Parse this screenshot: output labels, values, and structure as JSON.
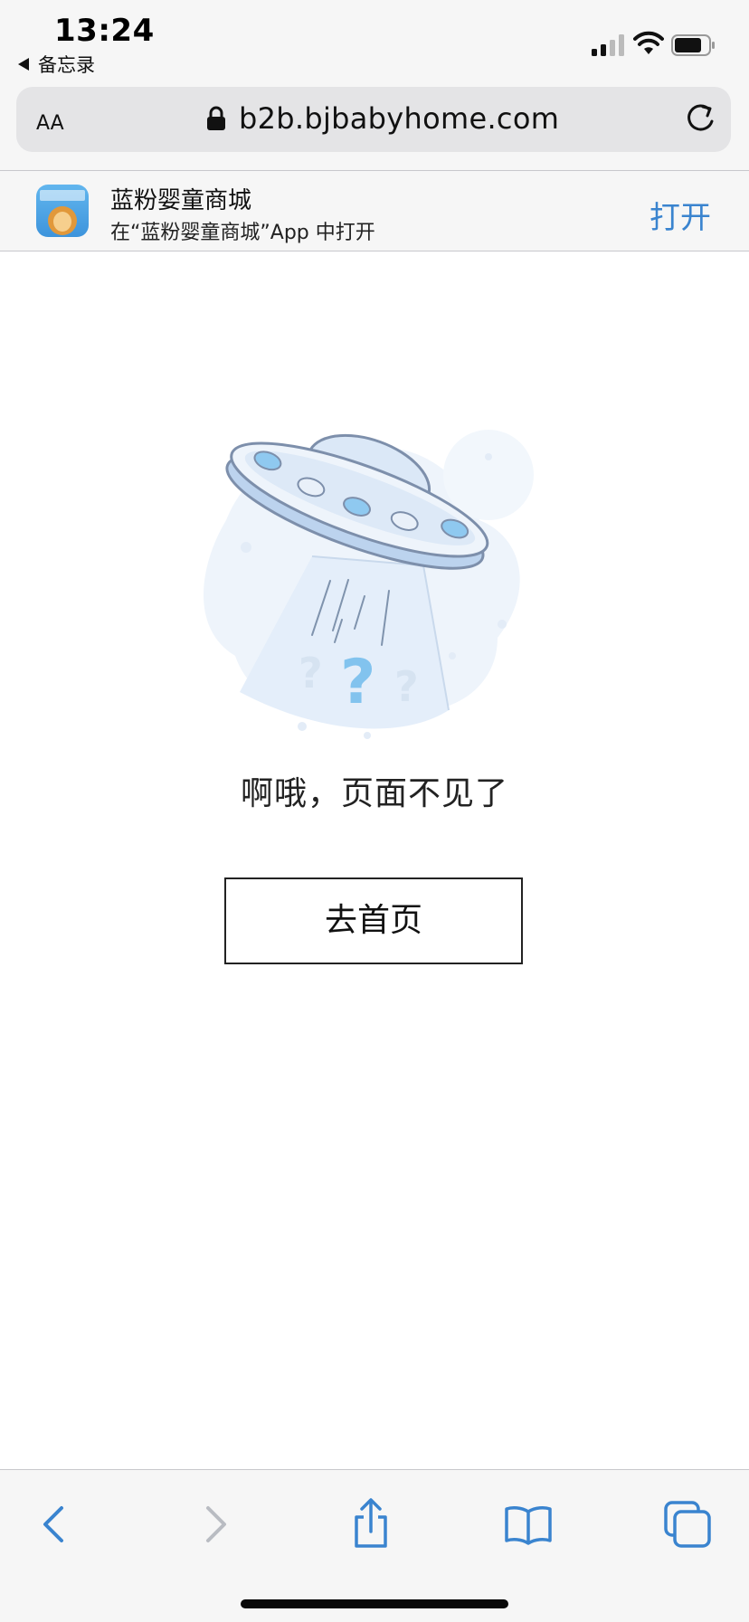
{
  "status_bar": {
    "time": "13:24",
    "back_label": "备忘录"
  },
  "url_bar": {
    "text_size_label": "AA",
    "url": "b2b.bjbabyhome.com"
  },
  "app_banner": {
    "app_name": "蓝粉婴童商城",
    "subtitle": "在“蓝粉婴童商城”App 中打开",
    "open_label": "打开"
  },
  "error_page": {
    "message": "啊哦，页面不见了",
    "home_button_label": "去首页"
  },
  "toolbar": {
    "items": [
      "back-icon",
      "forward-icon",
      "share-icon",
      "bookmarks-icon",
      "tabs-icon"
    ]
  },
  "colors": {
    "accent": "#3a84cf",
    "chrome_bg": "#f6f6f6",
    "ufo_blue": "#8fc9f0"
  }
}
